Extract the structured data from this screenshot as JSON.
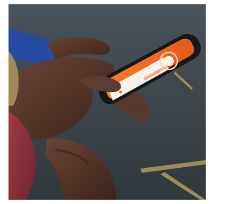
{
  "photo": {
    "colors": {
      "white_border": "#ffffff",
      "pavement": "#414950",
      "yellow_lines": "#b5a35a",
      "phone_body": "#171717",
      "app_orange": "#f26f22",
      "app_light": "#f7f7f7",
      "skin_dark": "#4b3026",
      "sleeve_blue": "#274aa1",
      "shirt_red": "#8b2d38"
    }
  }
}
